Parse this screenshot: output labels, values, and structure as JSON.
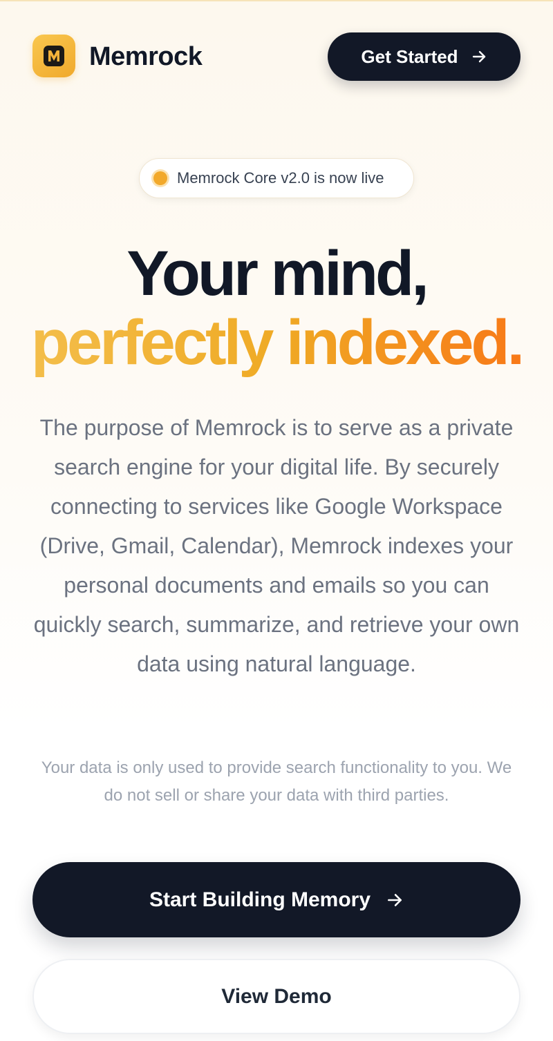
{
  "header": {
    "brand_name": "Memrock",
    "logo_icon": "memrock-logo-icon",
    "cta_label": "Get Started"
  },
  "badge": {
    "text": "Memrock Core v2.0 is now live"
  },
  "hero": {
    "headline_line1": "Your mind,",
    "headline_line2": "perfectly indexed.",
    "description": "The purpose of Memrock is to serve as a private search engine for your digital life. By securely connecting to services like Google Workspace (Drive, Gmail, Calendar), Memrock indexes your personal documents and emails so you can quickly search, summarize, and retrieve your own data using natural language.",
    "privacy_note": "Your data is only used to provide search functionality to you. We do not sell or share your data with third parties."
  },
  "actions": {
    "primary_label": "Start Building Memory",
    "secondary_label": "View Demo"
  },
  "colors": {
    "dark": "#121827",
    "accent": "#f2a92b",
    "accent_end": "#f97316",
    "muted_text": "#6b7280",
    "light_text": "#9ca3af"
  }
}
